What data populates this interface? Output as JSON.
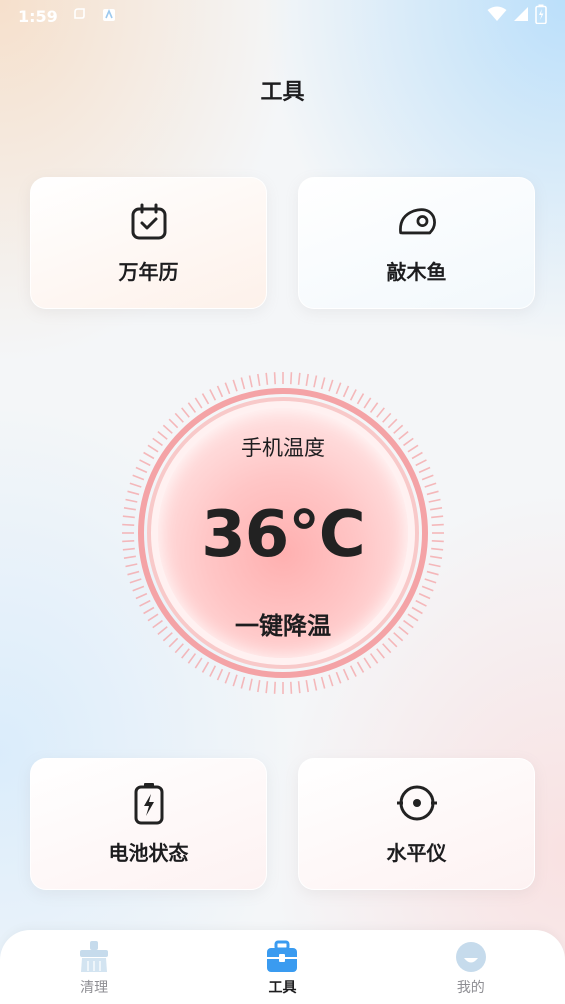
{
  "status_bar": {
    "time": "1:59",
    "left_icons": [
      "notification-icon",
      "app-notification-icon"
    ],
    "right_icons": [
      "wifi-icon",
      "signal-icon",
      "battery-icon"
    ]
  },
  "page": {
    "title": "工具"
  },
  "tools_top": [
    {
      "label": "万年历",
      "icon": "calendar-check-icon"
    },
    {
      "label": "敲木鱼",
      "icon": "wooden-fish-icon"
    }
  ],
  "temperature": {
    "title": "手机温度",
    "value": "36℃",
    "action": "一键降温"
  },
  "tools_bottom": [
    {
      "label": "电池状态",
      "icon": "battery-charging-icon"
    },
    {
      "label": "水平仪",
      "icon": "level-icon"
    }
  ],
  "tab_bar": {
    "active_index": 1,
    "tabs": [
      {
        "label": "清理",
        "icon": "broom-icon"
      },
      {
        "label": "工具",
        "icon": "toolbox-icon"
      },
      {
        "label": "我的",
        "icon": "profile-icon"
      }
    ]
  },
  "colors": {
    "accent_pink": "#f4a3a6",
    "tab_active_blue": "#3a9bf0",
    "tab_inactive": "#c6dbec",
    "text_primary": "#1d1d1f"
  }
}
